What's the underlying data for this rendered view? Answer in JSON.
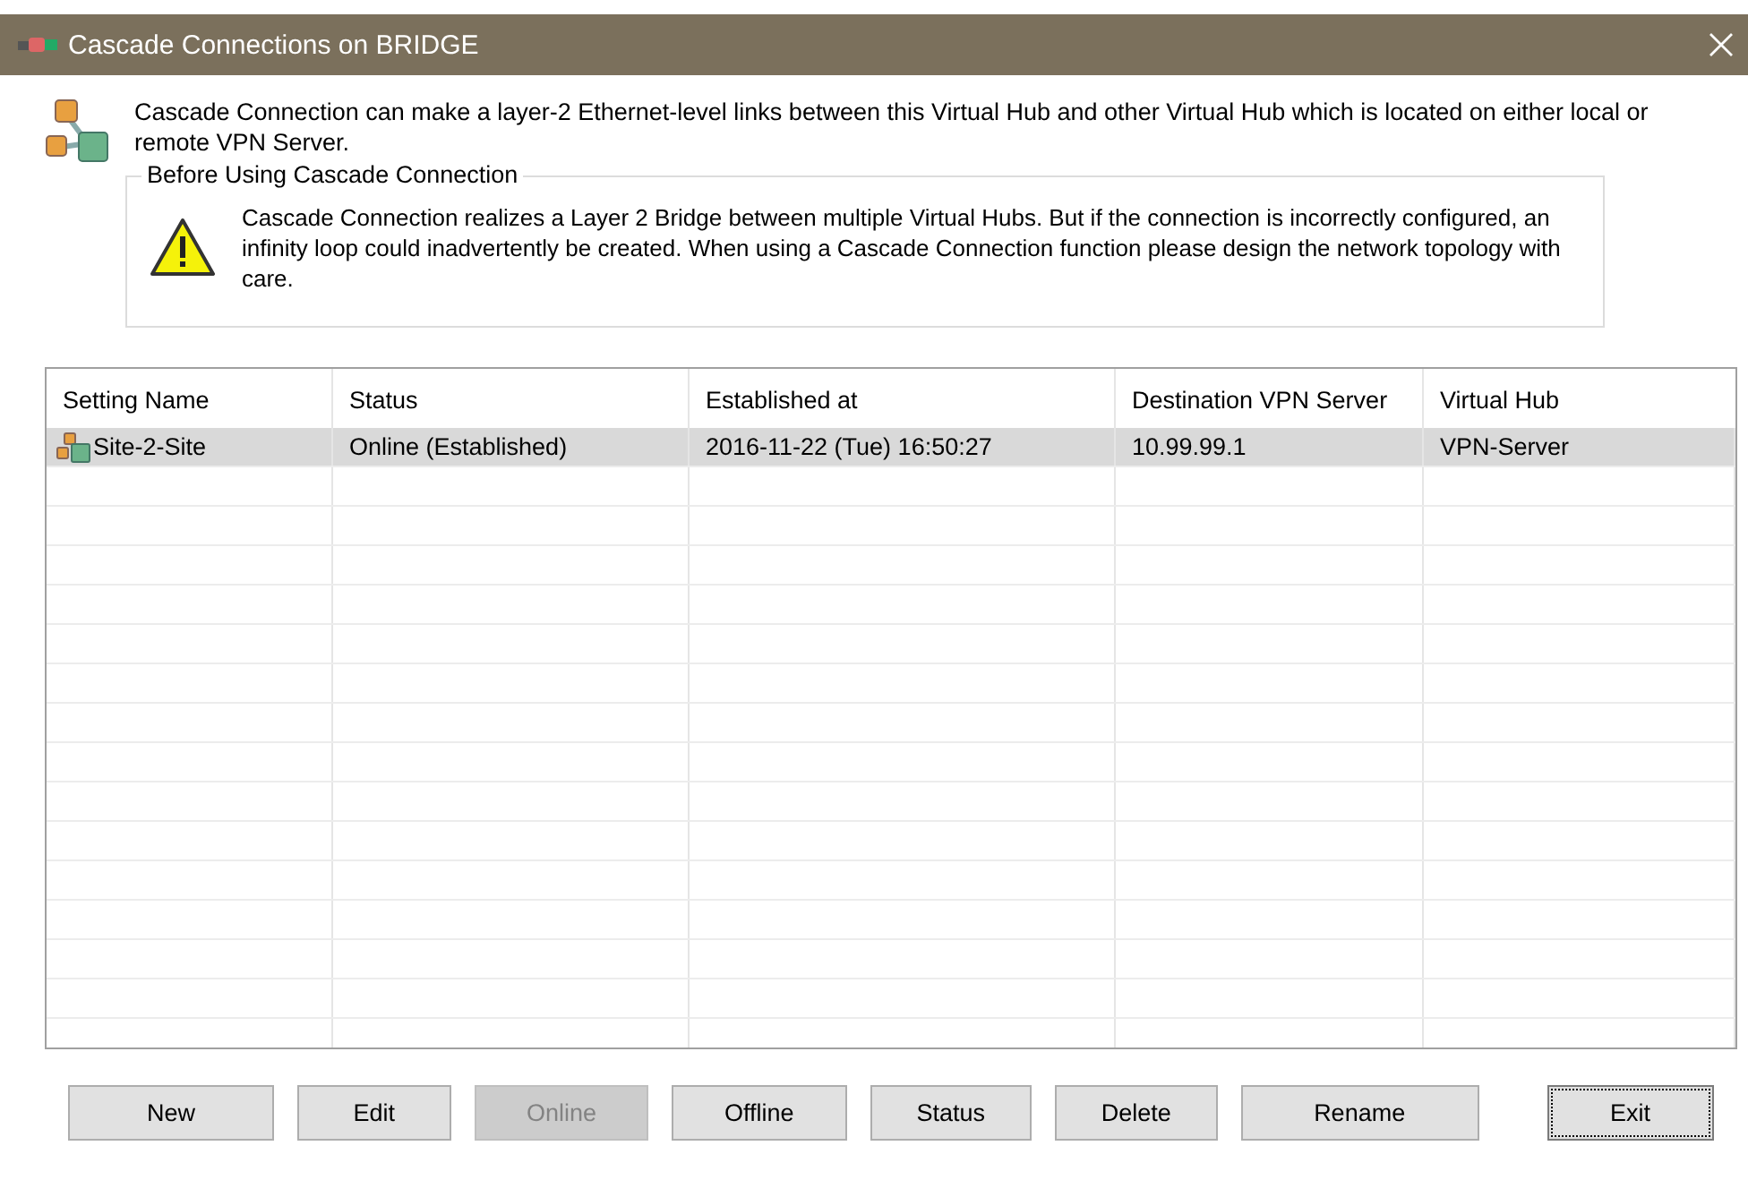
{
  "window": {
    "title": "Cascade Connections on BRIDGE"
  },
  "intro": "Cascade Connection can make a layer-2 Ethernet-level links between this Virtual Hub and other Virtual Hub which is located on either local or remote VPN Server.",
  "warning_group": {
    "title": "Before Using Cascade Connection",
    "text": "Cascade Connection realizes a Layer 2 Bridge between multiple Virtual Hubs. But if the connection is incorrectly configured, an infinity loop could inadvertently be created. When using a Cascade Connection function please design the network topology with care."
  },
  "table": {
    "columns": [
      "Setting Name",
      "Status",
      "Established at",
      "Destination VPN Server",
      "Virtual Hub"
    ],
    "rows": [
      {
        "selected": true,
        "cells": [
          "Site-2-Site",
          "Online (Established)",
          "2016-11-22 (Tue) 16:50:27",
          "10.99.99.1",
          "VPN-Server"
        ]
      }
    ]
  },
  "buttons": [
    {
      "label": "New",
      "disabled": false,
      "focused": false
    },
    {
      "label": "Edit",
      "disabled": false,
      "focused": false
    },
    {
      "label": "Online",
      "disabled": true,
      "focused": false
    },
    {
      "label": "Offline",
      "disabled": false,
      "focused": false
    },
    {
      "label": "Status",
      "disabled": false,
      "focused": false
    },
    {
      "label": "Delete",
      "disabled": false,
      "focused": false
    },
    {
      "label": "Rename",
      "disabled": false,
      "focused": false
    },
    {
      "label": "Exit",
      "disabled": false,
      "focused": true
    }
  ]
}
